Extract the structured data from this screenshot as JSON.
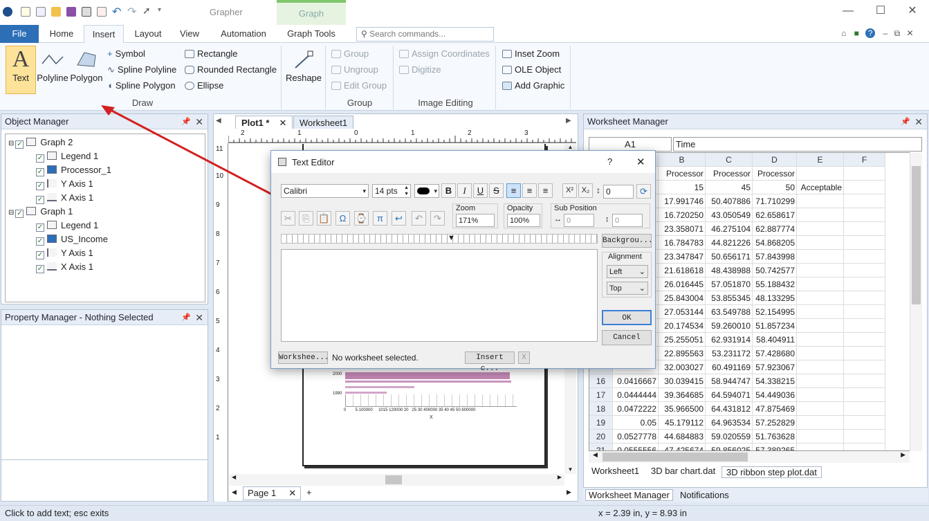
{
  "app": {
    "title": "Grapher",
    "context_tab": "Graph",
    "window_buttons": [
      "—",
      "☐",
      "✕"
    ]
  },
  "ribbon": {
    "file": "File",
    "tabs": [
      "Home",
      "Insert",
      "Layout",
      "View",
      "Automation",
      "Graph Tools"
    ],
    "search_placeholder": "Search commands...",
    "draw": {
      "text": "Text",
      "polyline": "Polyline",
      "polygon": "Polygon",
      "symbol": "Symbol",
      "spline_polyline": "Spline Polyline",
      "spline_polygon": "Spline Polygon",
      "rectangle": "Rectangle",
      "rounded_rectangle": "Rounded Rectangle",
      "ellipse": "Ellipse",
      "label": "Draw"
    },
    "reshape": "Reshape",
    "group": {
      "group": "Group",
      "ungroup": "Ungroup",
      "edit_group": "Edit Group",
      "label": "Group"
    },
    "image_editing": {
      "assign": "Assign Coordinates",
      "digitize": "Digitize",
      "label": "Image Editing"
    },
    "insert": {
      "inset_zoom": "Inset Zoom",
      "ole_object": "OLE Object",
      "add_graphic": "Add Graphic"
    }
  },
  "object_manager": {
    "title": "Object Manager",
    "tree": [
      {
        "label": "Graph 2",
        "level": 0
      },
      {
        "label": "Legend 1",
        "level": 1
      },
      {
        "label": "Processor_1",
        "level": 1
      },
      {
        "label": "Y Axis 1",
        "level": 1
      },
      {
        "label": "X Axis 1",
        "level": 1
      },
      {
        "label": "Graph 1",
        "level": 0
      },
      {
        "label": "Legend 1",
        "level": 1
      },
      {
        "label": "US_Income",
        "level": 1
      },
      {
        "label": "Y Axis 1",
        "level": 1
      },
      {
        "label": "X Axis 1",
        "level": 1
      }
    ]
  },
  "property_manager": {
    "title": "Property Manager - Nothing Selected"
  },
  "document": {
    "tabs": [
      "Plot1 *",
      "Worksheet1"
    ],
    "page_tab": "Page 1",
    "add_tab": "+",
    "ruler_top": [
      "2",
      "1",
      "0",
      "1",
      "2",
      "3"
    ],
    "ruler_left": [
      "11",
      "10",
      "9",
      "8",
      "7",
      "6",
      "5",
      "4",
      "3",
      "2",
      "1"
    ],
    "chart_ticks_y": [
      "2000",
      "1990"
    ],
    "chart_ticks_x": [
      "0",
      "5",
      "100000",
      "10",
      "15",
      "120000",
      "20",
      "25",
      "30",
      "400000",
      "35",
      "40",
      "45",
      "50",
      "600000"
    ],
    "chart_xlabel": "X"
  },
  "text_editor": {
    "title": "Text Editor",
    "help": "?",
    "close": "✕",
    "font": "Calibri",
    "size": "14 pts",
    "super": "X²",
    "sub": "X₂",
    "offset": "0",
    "zoom_label": "Zoom",
    "zoom": "171%",
    "opacity_label": "Opacity",
    "opacity": "100%",
    "subpos_label": "Sub Position",
    "subpos_h": "0",
    "subpos_v": "0",
    "background": "Backgrou...",
    "alignment_label": "Alignment",
    "align_h": "Left",
    "align_v": "Top",
    "ok": "OK",
    "cancel": "Cancel",
    "worksheet": "Workshee...",
    "no_ws": "No worksheet selected.",
    "insert_cell": "Insert c...",
    "clear": "X"
  },
  "worksheet_manager": {
    "title": "Worksheet Manager",
    "cell_ref": "A1",
    "cell_value": "Time",
    "columns": [
      "A",
      "B",
      "C",
      "D",
      "E",
      "F"
    ],
    "header_rows": [
      [
        "",
        "Processor",
        "Processor",
        "Processor",
        "",
        ""
      ],
      [
        "",
        "15",
        "45",
        "50",
        "Acceptable",
        ""
      ]
    ],
    "rows": [
      {
        "n": "",
        "a": "",
        "b": "17.991746",
        "c": "50.407886",
        "d": "71.710299"
      },
      {
        "n": "",
        "a": "",
        "b": "16.720250",
        "c": "43.050549",
        "d": "62.658617"
      },
      {
        "n": "",
        "a": "",
        "b": "23.358071",
        "c": "46.275104",
        "d": "62.887774"
      },
      {
        "n": "",
        "a": "",
        "b": "16.784783",
        "c": "44.821226",
        "d": "54.868205"
      },
      {
        "n": "",
        "a": "",
        "b": "23.347847",
        "c": "50.656171",
        "d": "57.843998"
      },
      {
        "n": "",
        "a": "",
        "b": "21.618618",
        "c": "48.438988",
        "d": "50.742577"
      },
      {
        "n": "",
        "a": "",
        "b": "26.016445",
        "c": "57.051870",
        "d": "55.188432"
      },
      {
        "n": "",
        "a": "",
        "b": "25.843004",
        "c": "53.855345",
        "d": "48.133295"
      },
      {
        "n": "",
        "a": "",
        "b": "27.053144",
        "c": "63.549788",
        "d": "52.154995"
      },
      {
        "n": "",
        "a": "",
        "b": "20.174534",
        "c": "59.260010",
        "d": "51.857234"
      },
      {
        "n": "",
        "a": "",
        "b": "25.255051",
        "c": "62.931914",
        "d": "58.404911"
      },
      {
        "n": "",
        "a": "",
        "b": "22.895563",
        "c": "53.231172",
        "d": "57.428680"
      },
      {
        "n": "",
        "a": "",
        "b": "32.003027",
        "c": "60.491169",
        "d": "57.923067"
      },
      {
        "n": "16",
        "a": "0.0416667",
        "b": "30.039415",
        "c": "58.944747",
        "d": "54.338215"
      },
      {
        "n": "17",
        "a": "0.0444444",
        "b": "39.364685",
        "c": "64.594071",
        "d": "54.449036"
      },
      {
        "n": "18",
        "a": "0.0472222",
        "b": "35.966500",
        "c": "64.431812",
        "d": "47.875469"
      },
      {
        "n": "19",
        "a": "0.05",
        "b": "45.179112",
        "c": "64.963534",
        "d": "57.252829"
      },
      {
        "n": "20",
        "a": "0.0527778",
        "b": "44.684883",
        "c": "59.020559",
        "d": "51.763628"
      },
      {
        "n": "21",
        "a": "0.0555556",
        "b": "47.425674",
        "c": "59.856025",
        "d": "57.389265"
      }
    ],
    "sheet_tabs": [
      "Worksheet1",
      "3D bar chart.dat",
      "3D ribbon step plot.dat"
    ],
    "bottom_tabs": [
      "Worksheet Manager",
      "Notifications"
    ]
  },
  "status": {
    "left": "Click to add text; esc exits",
    "coords": "x = 2.39 in, y = 8.93 in"
  },
  "colors": {
    "accent": "#2c6fb7",
    "text_button_bg": "#fde29a",
    "arrow": "#d42020",
    "bar": "#b36aa3"
  }
}
